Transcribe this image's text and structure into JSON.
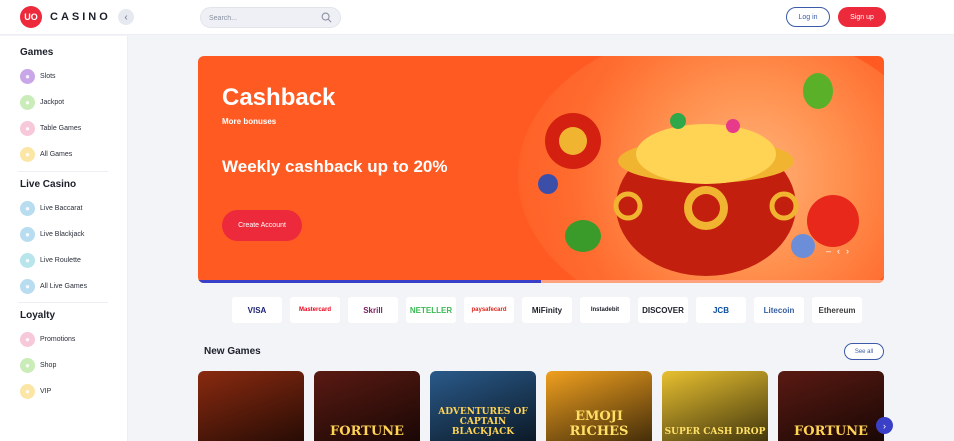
{
  "header": {
    "logo_mark": "UO",
    "logo_text": "CASINO",
    "collapse_icon": "chevron-left-icon",
    "search_placeholder": "Search...",
    "login_label": "Log in",
    "signup_label": "Sign up"
  },
  "sidebar": {
    "games_title": "Games",
    "games_items": [
      {
        "label": "Slots",
        "icon": "slots-icon",
        "color": "#c8a6e8"
      },
      {
        "label": "Jackpot",
        "icon": "jackpot-icon",
        "color": "#c9ecb8"
      },
      {
        "label": "Table Games",
        "icon": "table-games-icon",
        "color": "#f7c8d9"
      },
      {
        "label": "All Games",
        "icon": "all-games-icon",
        "color": "#fbe6a6"
      }
    ],
    "live_title": "Live Casino",
    "live_items": [
      {
        "label": "Live Baccarat",
        "icon": "baccarat-icon",
        "color": "#b8dcf0"
      },
      {
        "label": "Live Blackjack",
        "icon": "blackjack-icon",
        "color": "#b8dcf0"
      },
      {
        "label": "Live Roulette",
        "icon": "roulette-icon",
        "color": "#b8e4ec"
      },
      {
        "label": "All Live Games",
        "icon": "all-live-games-icon",
        "color": "#b8dcf0"
      }
    ],
    "loyalty_title": "Loyalty",
    "loyalty_items": [
      {
        "label": "Promotions",
        "icon": "promotions-icon",
        "color": "#f7c8d9"
      },
      {
        "label": "Shop",
        "icon": "shop-icon",
        "color": "#c9ecb8"
      },
      {
        "label": "VIP",
        "icon": "vip-icon",
        "color": "#fbe6a6"
      }
    ]
  },
  "banner": {
    "title": "Cashback",
    "subtitle": "More bonuses",
    "offer": "Weekly cashback up to 20%",
    "cta_label": "Create Account",
    "progress": 0.5,
    "nav_prev": "‹",
    "nav_next": "›"
  },
  "payments": [
    "VISA",
    "Mastercard",
    "Skrill",
    "NETELLER",
    "paysafecard",
    "MiFinity",
    "Instadebit",
    "DISCOVER",
    "JCB",
    "Litecoin",
    "Ethereum"
  ],
  "new_games": {
    "title": "New Games",
    "see_all_label": "See all",
    "next_icon": "chevron-right-icon",
    "games": [
      {
        "title": "",
        "bg": "#8a2a10"
      },
      {
        "title": "FORTUNE",
        "bg": "#5a1a12"
      },
      {
        "title": "ADVENTURES OF CAPTAIN BLACKJACK",
        "bg": "#2a5a8a"
      },
      {
        "title": "EMOJI RICHES",
        "bg": "#f0a020"
      },
      {
        "title": "SUPER CASH DROP",
        "bg": "#e8c030"
      },
      {
        "title": "FORTUNE",
        "bg": "#5a1a12"
      }
    ]
  },
  "colors": {
    "brand_red": "#ed2a3b",
    "banner_orange": "#ff5a22",
    "accent_blue": "#3b5ba9"
  }
}
